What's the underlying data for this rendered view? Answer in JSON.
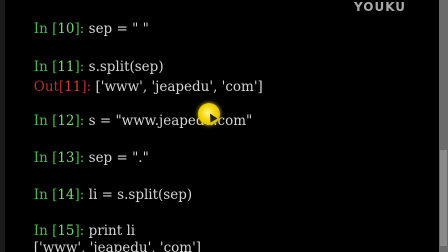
{
  "watermark": "YOUKU",
  "cells": [
    {
      "prompt": "In [",
      "num": "10",
      "suffix": "]: ",
      "code": "sep = \" \""
    },
    {
      "prompt": "In [",
      "num": "11",
      "suffix": "]: ",
      "code": "s.split(sep)"
    },
    {
      "out_prompt": "Out[",
      "out_num": "11",
      "out_suffix": "]: ",
      "output": "['www', 'jeapedu', 'com']"
    },
    {
      "prompt": "In [",
      "num": "12",
      "suffix": "]: ",
      "code": "s = \"www.jeapedu.com\""
    },
    {
      "prompt": "In [",
      "num": "13",
      "suffix": "]: ",
      "code": "sep = \".\""
    },
    {
      "prompt": "In [",
      "num": "14",
      "suffix": "]: ",
      "code": "li = s.split(sep)"
    },
    {
      "prompt": "In [",
      "num": "15",
      "suffix": "]: ",
      "code": "print li"
    },
    {
      "output": "['www', 'jeapedu', 'com']"
    }
  ]
}
